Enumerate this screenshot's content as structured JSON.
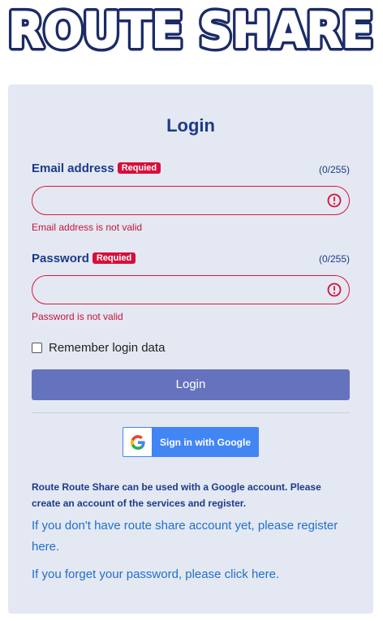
{
  "app": {
    "logo_text": "ROUTE SHARE",
    "accent_color": "#1b3b8a",
    "error_color": "#d60f3c"
  },
  "login": {
    "title": "Login",
    "email": {
      "label": "Email address",
      "badge": "Requied",
      "counter": "(0/255)",
      "value": "",
      "error": "Email address is not valid",
      "icon": "error-circle-icon"
    },
    "password": {
      "label": "Password",
      "badge": "Requied",
      "counter": "(0/255)",
      "value": "",
      "error": "Password is not valid",
      "icon": "error-circle-icon"
    },
    "remember_label": "Remember login data",
    "remember_checked": false,
    "submit_label": "Login",
    "google_label": "Sign in with Google",
    "google_icon": "google-g-icon",
    "note": "Route Route Share can be used with a Google account. Please create an account of the services and register.",
    "register_link": "If you don't have route share account yet, please register here.",
    "forgot_link": "If you forget your password, please click here."
  }
}
